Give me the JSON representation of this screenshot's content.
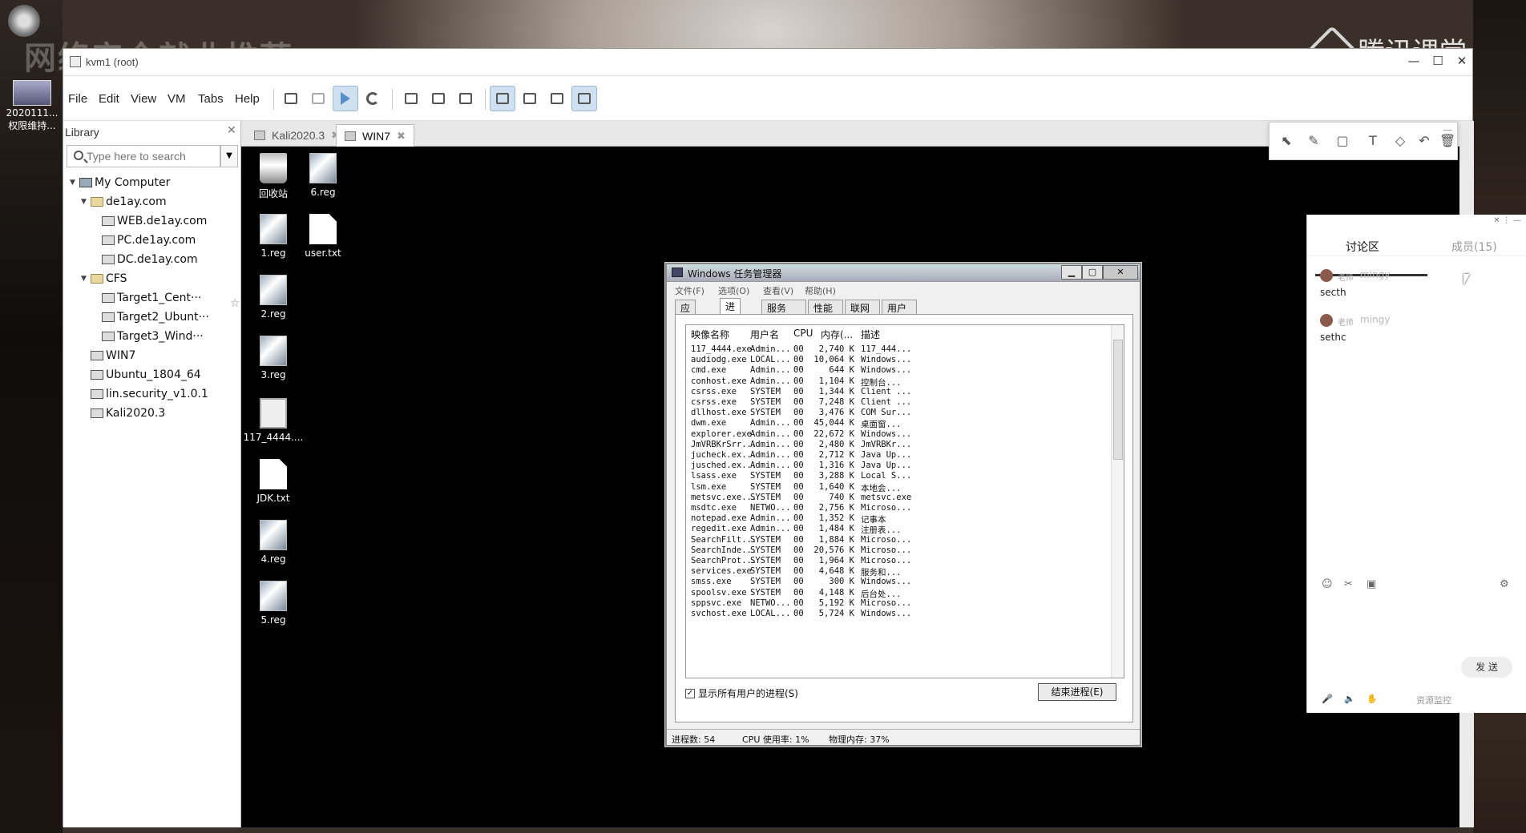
{
  "overlay": {
    "title": "网络安全就业推荐",
    "brand": "腾讯课堂"
  },
  "desktop_icons": [
    {
      "label": "2020111...\n权限维持..."
    }
  ],
  "window": {
    "title": "kvm1 (root)",
    "minimize": "—",
    "maximize": "☐",
    "close": "✕"
  },
  "menu": [
    "File",
    "Edit",
    "View",
    "VM",
    "Tabs",
    "Help"
  ],
  "library": {
    "header": "Library",
    "close": "✕",
    "search_placeholder": "Type here to search",
    "tree": [
      {
        "label": "My Computer",
        "level": 0,
        "icon": "computer-icon",
        "expanded": true
      },
      {
        "label": "de1ay.com",
        "level": 1,
        "icon": "folder-icon",
        "expanded": true
      },
      {
        "label": "WEB.de1ay.com",
        "level": 2,
        "icon": "vm-icon"
      },
      {
        "label": "PC.de1ay.com",
        "level": 2,
        "icon": "vm-icon"
      },
      {
        "label": "DC.de1ay.com",
        "level": 2,
        "icon": "vm-icon"
      },
      {
        "label": "CFS",
        "level": 1,
        "icon": "folder-icon",
        "expanded": true
      },
      {
        "label": "Target1_Cent···",
        "level": 2,
        "icon": "vm-icon"
      },
      {
        "label": "Target2_Ubunt···",
        "level": 2,
        "icon": "vm-icon"
      },
      {
        "label": "Target3_Wind···",
        "level": 2,
        "icon": "vm-icon"
      },
      {
        "label": "WIN7",
        "level": 1,
        "icon": "vm-icon"
      },
      {
        "label": "Ubuntu_1804_64",
        "level": 1,
        "icon": "vm-icon"
      },
      {
        "label": "lin.security_v1.0.1",
        "level": 1,
        "icon": "vm-icon"
      },
      {
        "label": "Kali2020.3",
        "level": 1,
        "icon": "vm-icon"
      }
    ]
  },
  "tabs": [
    {
      "label": "Kali2020.3",
      "active": false
    },
    {
      "label": "WIN7",
      "active": true
    }
  ],
  "guest_desktop": [
    {
      "label": "回收站",
      "type": "bin"
    },
    {
      "label": "6.reg",
      "type": "reg"
    },
    {
      "label": "1.reg",
      "type": "reg"
    },
    {
      "label": "user.txt",
      "type": "txt"
    },
    {
      "label": "2.reg",
      "type": "reg"
    },
    {
      "label": "3.reg",
      "type": "reg"
    },
    {
      "label": "117_4444....",
      "type": "exe"
    },
    {
      "label": "JDK.txt",
      "type": "txt"
    },
    {
      "label": "4.reg",
      "type": "reg"
    },
    {
      "label": "5.reg",
      "type": "reg"
    }
  ],
  "task_manager": {
    "title": "Windows 任务管理器",
    "menu": [
      "文件(F)",
      "选项(O)",
      "查看(V)",
      "帮助(H)"
    ],
    "tabs": [
      "应用程序",
      "进程",
      "服务",
      "性能",
      "联网",
      "用户"
    ],
    "active_tab": "进程",
    "columns": [
      "映像名称",
      "用户名",
      "CPU",
      "内存(...",
      "描述"
    ],
    "processes": [
      [
        "117_4444.exe",
        "Admin...",
        "00",
        "2,740 K",
        "117_444..."
      ],
      [
        "audiodg.exe",
        "LOCAL...",
        "00",
        "10,064 K",
        "Windows..."
      ],
      [
        "cmd.exe",
        "Admin...",
        "00",
        "644 K",
        "Windows..."
      ],
      [
        "conhost.exe",
        "Admin...",
        "00",
        "1,104 K",
        "控制台..."
      ],
      [
        "csrss.exe",
        "SYSTEM",
        "00",
        "1,344 K",
        "Client ..."
      ],
      [
        "csrss.exe",
        "SYSTEM",
        "00",
        "7,248 K",
        "Client ..."
      ],
      [
        "dllhost.exe",
        "SYSTEM",
        "00",
        "3,476 K",
        "COM Sur..."
      ],
      [
        "dwm.exe",
        "Admin...",
        "00",
        "45,044 K",
        "桌面窗..."
      ],
      [
        "explorer.exe",
        "Admin...",
        "00",
        "22,672 K",
        "Windows..."
      ],
      [
        "JmVRBKrSrr...",
        "Admin...",
        "00",
        "2,480 K",
        "JmVRBKr..."
      ],
      [
        "jucheck.ex...",
        "Admin...",
        "00",
        "2,712 K",
        "Java Up..."
      ],
      [
        "jusched.ex...",
        "Admin...",
        "00",
        "1,316 K",
        "Java Up..."
      ],
      [
        "lsass.exe",
        "SYSTEM",
        "00",
        "3,288 K",
        "Local S..."
      ],
      [
        "lsm.exe",
        "SYSTEM",
        "00",
        "1,640 K",
        "本地会..."
      ],
      [
        "metsvc.exe...",
        "SYSTEM",
        "00",
        "740 K",
        "metsvc.exe"
      ],
      [
        "msdtc.exe",
        "NETWO...",
        "00",
        "2,756 K",
        "Microso..."
      ],
      [
        "notepad.exe",
        "Admin...",
        "00",
        "1,352 K",
        "记事本"
      ],
      [
        "regedit.exe",
        "Admin...",
        "00",
        "1,484 K",
        "注册表..."
      ],
      [
        "SearchFilt...",
        "SYSTEM",
        "00",
        "1,884 K",
        "Microso..."
      ],
      [
        "SearchInde...",
        "SYSTEM",
        "00",
        "20,576 K",
        "Microso..."
      ],
      [
        "SearchProt...",
        "SYSTEM",
        "00",
        "1,964 K",
        "Microso..."
      ],
      [
        "services.exe",
        "SYSTEM",
        "00",
        "4,648 K",
        "服务和..."
      ],
      [
        "smss.exe",
        "SYSTEM",
        "00",
        "300 K",
        "Windows..."
      ],
      [
        "spoolsv.exe",
        "SYSTEM",
        "00",
        "4,148 K",
        "后台处..."
      ],
      [
        "sppsvc.exe",
        "NETWO...",
        "00",
        "5,192 K",
        "Microso..."
      ],
      [
        "svchost.exe",
        "LOCAL...",
        "00",
        "5,724 K",
        "Windows..."
      ]
    ],
    "show_all_label": "显示所有用户的进程(S)",
    "end_process_label": "结束进程(E)",
    "status": {
      "process_count": "进程数: 54",
      "cpu": "CPU 使用率: 1%",
      "memory": "物理内存: 37%"
    }
  },
  "discussion": {
    "tab_discussion": "讨论区",
    "tab_members": "成员(15)",
    "messages": [
      {
        "role": "老师",
        "name": "mingy",
        "text": "secth"
      },
      {
        "role": "老师",
        "name": "mingy",
        "text": "sethc"
      }
    ],
    "send_label": "发 送",
    "resource_monitor": "资源监控"
  }
}
